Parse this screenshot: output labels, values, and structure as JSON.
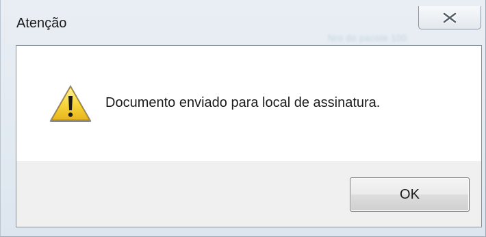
{
  "window": {
    "title": "Atenção",
    "close_icon": "close-icon",
    "background_ghost_text": "Nro do pacote 100"
  },
  "dialog": {
    "icon": "warning-icon",
    "message": "Documento enviado para local de assinatura.",
    "ok_label": "OK"
  },
  "colors": {
    "frame": "#e3eaf2",
    "button_area": "#f0f0f0",
    "warning_yellow": "#f5d33a"
  }
}
